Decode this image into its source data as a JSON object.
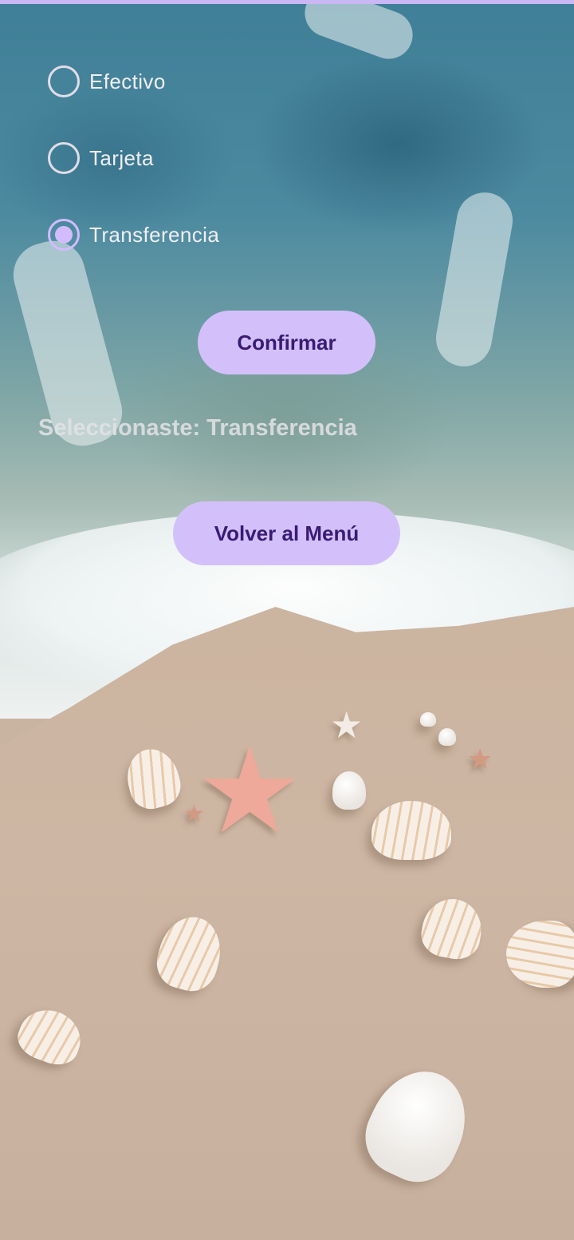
{
  "payment_options": [
    {
      "label": "Efectivo",
      "selected": false
    },
    {
      "label": "Tarjeta",
      "selected": false
    },
    {
      "label": "Transferencia",
      "selected": true
    }
  ],
  "confirm_button": {
    "label": "Confirmar"
  },
  "selection_text": "Seleccionaste: Transferencia",
  "back_button": {
    "label": "Volver al Menú"
  },
  "colors": {
    "accent": "#d2bcfd",
    "button_bg": "#d3c0fb",
    "button_text": "#3a1c73",
    "label_text": "#f1eef4"
  },
  "icons": {
    "radio_unchecked": "radio-unchecked-icon",
    "radio_checked": "radio-checked-icon"
  }
}
